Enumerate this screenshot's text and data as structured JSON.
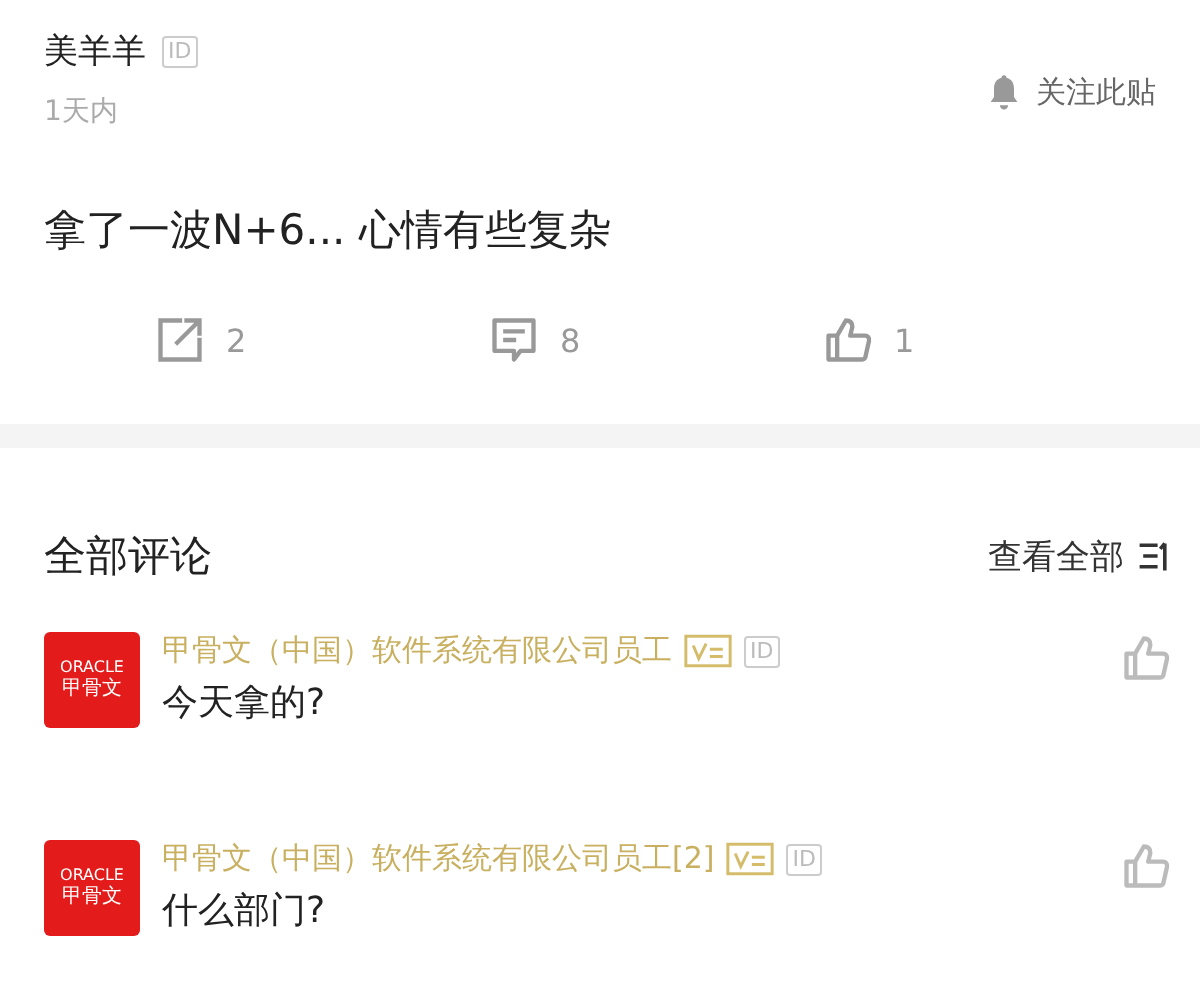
{
  "post": {
    "author": "美羊羊",
    "id_badge": "ID",
    "time": "1天内",
    "follow": "关注此贴",
    "text": "拿了一波N+6... 心情有些复杂",
    "actions": [
      {
        "kind": "share",
        "count": "2"
      },
      {
        "kind": "comment",
        "count": "8"
      },
      {
        "kind": "like",
        "count": "1"
      }
    ]
  },
  "comments_header": {
    "title": "全部评论",
    "view_all": "查看全部"
  },
  "comments": [
    {
      "avatar_lines": [
        "ORACLE",
        "甲骨文"
      ],
      "name": "甲骨文（中国）软件系统有限公司员工",
      "verified": true,
      "id_badge": "ID",
      "text": "今天拿的?"
    },
    {
      "avatar_lines": [
        "ORACLE",
        "甲骨文"
      ],
      "name": "甲骨文（中国）软件系统有限公司员工[2]",
      "verified": true,
      "id_badge": "ID",
      "text": "什么部门?"
    }
  ]
}
